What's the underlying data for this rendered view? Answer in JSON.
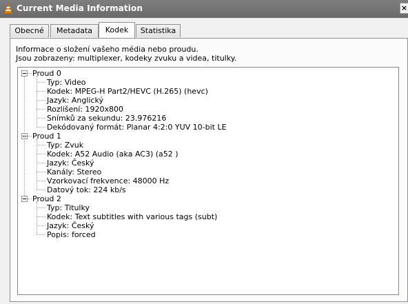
{
  "window": {
    "title": "Current Media Information",
    "close_label": "×"
  },
  "tabs": [
    {
      "label": "Obecné"
    },
    {
      "label": "Metadata"
    },
    {
      "label": "Kodek"
    },
    {
      "label": "Statistika"
    }
  ],
  "active_tab": "Kodek",
  "description": {
    "line1": "Informace o složení vašeho média nebo proudu.",
    "line2": "Jsou zobrazeny: multiplexer, kodeky zvuku a videa, titulky."
  },
  "streams": [
    {
      "label": "Proud 0",
      "items": [
        "Typ: Video",
        "Kodek: MPEG-H Part2/HEVC (H.265) (hevc)",
        "Jazyk: Anglický",
        "Rozlišení: 1920x800",
        "Snímků za sekundu: 23.976216",
        "Dekódovaný formát: Planar 4:2:0 YUV 10-bit LE"
      ]
    },
    {
      "label": "Proud 1",
      "items": [
        "Typ: Zvuk",
        "Kodek: A52 Audio (aka AC3) (a52 )",
        "Jazyk: Český",
        "Kanály: Stereo",
        "Vzorkovací frekvence: 48000 Hz",
        "Datový tok: 224 kb/s"
      ]
    },
    {
      "label": "Proud 2",
      "items": [
        "Typ: Titulky",
        "Kodek: Text subtitles with various tags (subt)",
        "Jazyk: Český",
        "Popis: forced"
      ]
    }
  ],
  "colors": {
    "titlebar": "#6e6e6e",
    "window_bg": "#f0f0f0",
    "panel_bg": "#fbfbfb",
    "tree_bg": "#ffffff",
    "vlc_orange": "#f08a00"
  },
  "icons": {
    "app": "vlc-cone-icon",
    "close": "close-icon",
    "expander": "minus-expander-icon"
  }
}
